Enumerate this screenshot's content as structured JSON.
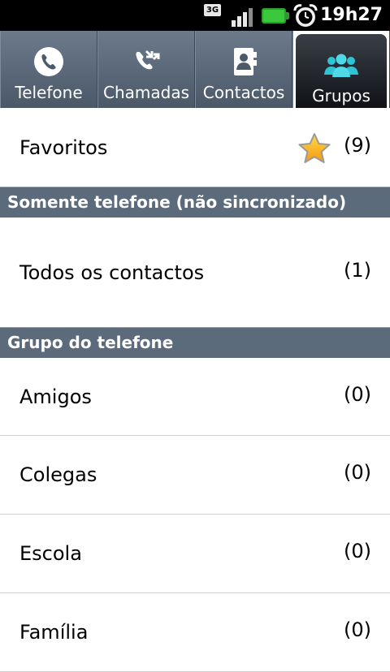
{
  "status_bar": {
    "network": "3G",
    "time": "19h27"
  },
  "tabs": [
    {
      "label": "Telefone",
      "icon": "phone-icon"
    },
    {
      "label": "Chamadas",
      "icon": "call-log-icon"
    },
    {
      "label": "Contactos",
      "icon": "contacts-icon"
    },
    {
      "label": "Grupos",
      "icon": "groups-icon",
      "active": true
    }
  ],
  "favorites": {
    "label": "Favoritos",
    "count": "(9)",
    "icon": "star-icon"
  },
  "sections": [
    {
      "header": "Somente telefone (não sincronizado)",
      "items": [
        {
          "label": "Todos os contactos",
          "count": "(1)"
        }
      ]
    },
    {
      "header": "Grupo do telefone",
      "items": [
        {
          "label": "Amigos",
          "count": "(0)"
        },
        {
          "label": "Colegas",
          "count": "(0)"
        },
        {
          "label": "Escola",
          "count": "(0)"
        },
        {
          "label": "Família",
          "count": "(0)"
        }
      ]
    }
  ],
  "colors": {
    "status_bar": "#000000",
    "tab_bar": "#5a6878",
    "section_header": "#5c6b7b",
    "accent_groups": "#2fc3d6",
    "battery": "#3cc83c"
  }
}
